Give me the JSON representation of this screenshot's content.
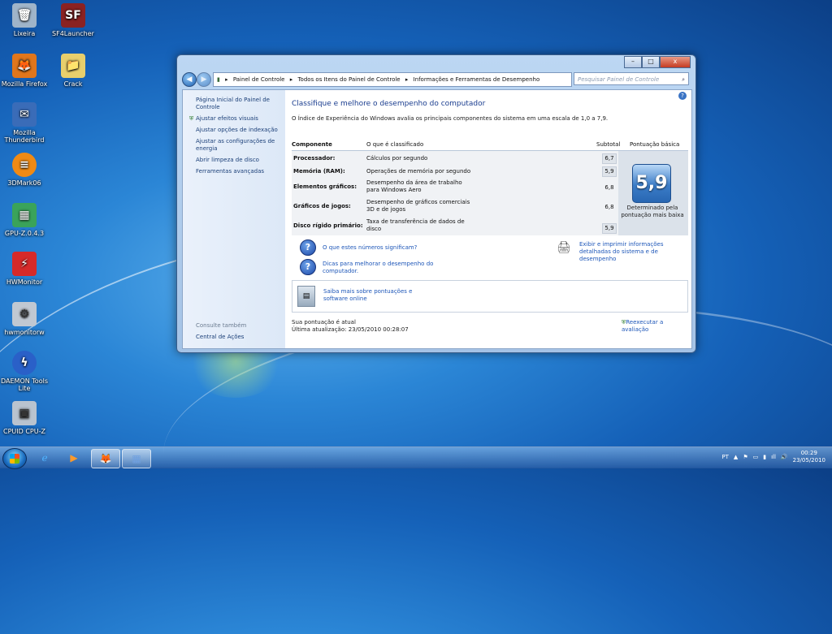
{
  "desktop": {
    "icons": [
      {
        "label": "Lixeira",
        "glyph": "🗑",
        "color": "#9fb4c9"
      },
      {
        "label": "SF4Launcher",
        "glyph": "SF",
        "color": "#8a2222"
      },
      {
        "label": "Mozilla Firefox",
        "glyph": "🦊",
        "color": "#e0761c"
      },
      {
        "label": "Crack",
        "glyph": "📁",
        "color": "#e8cf6c"
      },
      {
        "label": "Mozilla Thunderbird",
        "glyph": "✉",
        "color": "#3a6cb8"
      },
      {
        "label": "3DMark06",
        "glyph": "≡",
        "color": "#f08a14"
      },
      {
        "label": "GPU-Z.0.4.3",
        "glyph": "▦",
        "color": "#3aa35a"
      },
      {
        "label": "HWMonitor",
        "glyph": "⚡",
        "color": "#d62a2a"
      },
      {
        "label": "hwmonitorw",
        "glyph": "⚙",
        "color": "#c0c8d2"
      },
      {
        "label": "DAEMON Tools Lite",
        "glyph": "ϟ",
        "color": "#2a60c8"
      },
      {
        "label": "CPUID CPU-Z",
        "glyph": "▣",
        "color": "#b9c3cf"
      }
    ]
  },
  "window": {
    "controls": {
      "minimize": "–",
      "maximize": "□",
      "close": "x"
    },
    "breadcrumb": [
      "Painel de Controle",
      "Todos os Itens do Painel de Controle",
      "Informações e Ferramentas de Desempenho"
    ],
    "search_placeholder": "Pesquisar Painel de Controle",
    "sidebar": {
      "items": [
        "Página Inicial do Painel de Controle",
        "Ajustar efeitos visuais",
        "Ajustar opções de indexação",
        "Ajustar as configurações de energia",
        "Abrir limpeza de disco",
        "Ferramentas avançadas"
      ],
      "see_also_title": "Consulte também",
      "see_also": [
        "Central de Ações"
      ]
    },
    "main": {
      "title": "Classifique e melhore o desempenho do computador",
      "intro": "O Índice de Experiência do Windows avalia os principais componentes do sistema em uma escala de 1,0 a 7,9.",
      "headers": {
        "component": "Componente",
        "rated": "O que é classificado",
        "subtotal": "Subtotal",
        "base": "Pontuação básica"
      },
      "rows": [
        {
          "component": "Processador:",
          "rated": "Cálculos por segundo",
          "subtotal": "6,7"
        },
        {
          "component": "Memória (RAM):",
          "rated": "Operações de memória por segundo",
          "subtotal": "5,9"
        },
        {
          "component": "Elementos gráficos:",
          "rated": "Desempenho da área de trabalho para Windows Aero",
          "subtotal": "6,8"
        },
        {
          "component": "Gráficos de jogos:",
          "rated": "Desempenho de gráficos comerciais 3D e de jogos",
          "subtotal": "6,8"
        },
        {
          "component": "Disco rígido primário:",
          "rated": "Taxa de transferência de dados de disco",
          "subtotal": "5,9"
        }
      ],
      "base_score": "5,9",
      "base_caption": "Determinado pela pontuação mais baixa",
      "links": {
        "what_mean": "O que estes números significam?",
        "tips": "Dicas para melhorar o desempenho do computador.",
        "print": "Exibir e imprimir informações detalhadas do sistema e de desempenho",
        "learn_more": "Saiba mais sobre pontuações e software online",
        "rerun": "Reexecutar a avaliação"
      },
      "status": "Sua pontuação é atual",
      "last_update": "Última atualização: 23/05/2010 00:28:07"
    }
  },
  "taskbar": {
    "language": "PT",
    "time": "00:29",
    "date": "23/05/2010"
  }
}
